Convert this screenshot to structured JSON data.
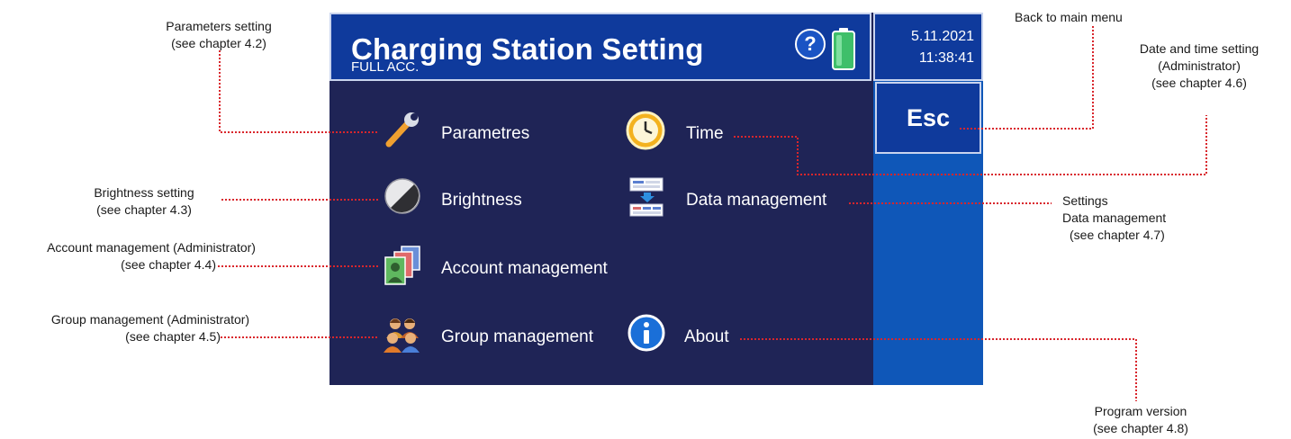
{
  "header": {
    "title": "Charging Station Setting",
    "subtitle": "FULL ACC.",
    "date": "5.11.2021",
    "time": "11:38:41",
    "help_icon": "help-icon",
    "battery_icon": "battery-icon"
  },
  "esc_label": "Esc",
  "menu": {
    "parameters": {
      "label": "Parametres",
      "icon": "wrench-icon"
    },
    "time": {
      "label": "Time",
      "icon": "clock-icon"
    },
    "brightness": {
      "label": "Brightness",
      "icon": "brightness-icon"
    },
    "data_management": {
      "label": "Data management",
      "icon": "data-transfer-icon"
    },
    "account_management": {
      "label": "Account management",
      "icon": "accounts-icon"
    },
    "group_management": {
      "label": "Group management",
      "icon": "group-icon"
    },
    "about": {
      "label": "About",
      "icon": "info-icon"
    }
  },
  "annotations": {
    "parameters": [
      "Parameters setting",
      "(see chapter 4.2)"
    ],
    "brightness": [
      "Brightness setting",
      "(see chapter 4.3)"
    ],
    "account": [
      "Account management (Administrator)",
      "(see chapter 4.4)"
    ],
    "group": [
      "Group management (Administrator)",
      "(see chapter 4.5)"
    ],
    "back": [
      "Back to main menu"
    ],
    "datetime": [
      "Date and time setting",
      "(Administrator)",
      "(see chapter 4.6)"
    ],
    "data": [
      "Settings",
      "Data management",
      "(see chapter 4.7)"
    ],
    "program": [
      "Program version",
      "(see chapter 4.8)"
    ]
  },
  "colors": {
    "screen_bg": "#1f2456",
    "title_bg": "#0f3a9c",
    "sidebar_bg": "#0f57b8",
    "leader": "#d9262c"
  }
}
